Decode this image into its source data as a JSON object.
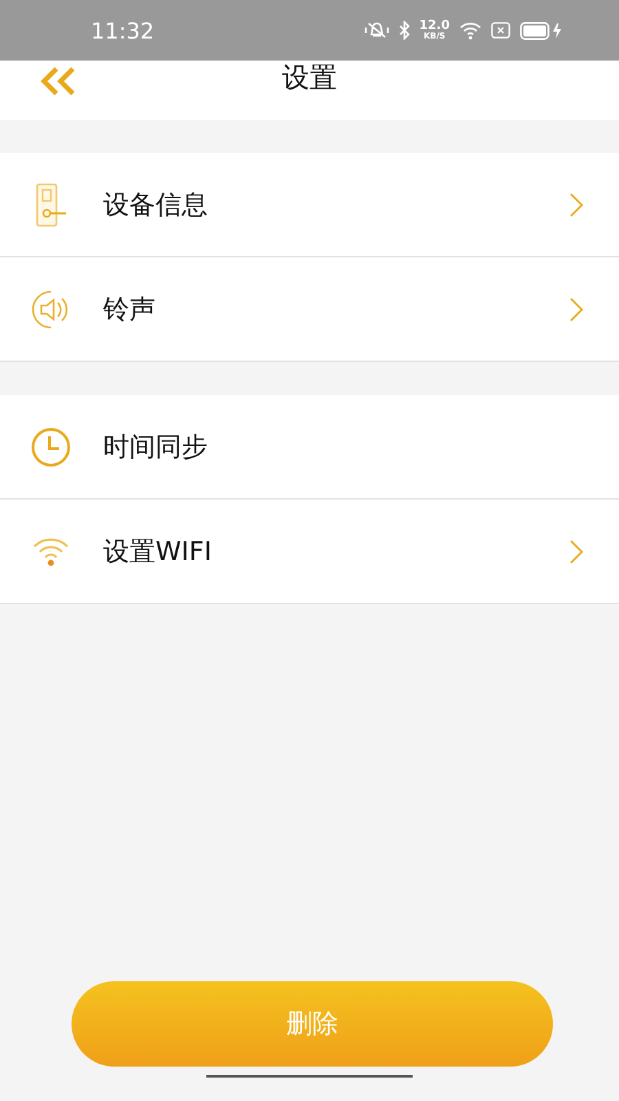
{
  "status_bar": {
    "time": "11:32",
    "speed": "12.0",
    "speed_unit": "KB/S"
  },
  "header": {
    "title": "设置"
  },
  "groups": [
    {
      "items": [
        {
          "kind": "lock",
          "label": "设备信息",
          "chevron": true
        },
        {
          "kind": "speaker",
          "label": "铃声",
          "chevron": true
        }
      ]
    },
    {
      "items": [
        {
          "kind": "clock",
          "label": "时间同步",
          "chevron": false
        },
        {
          "kind": "wifi",
          "label": "设置WIFI",
          "chevron": true
        }
      ]
    }
  ],
  "delete_button": {
    "label": "删除"
  }
}
